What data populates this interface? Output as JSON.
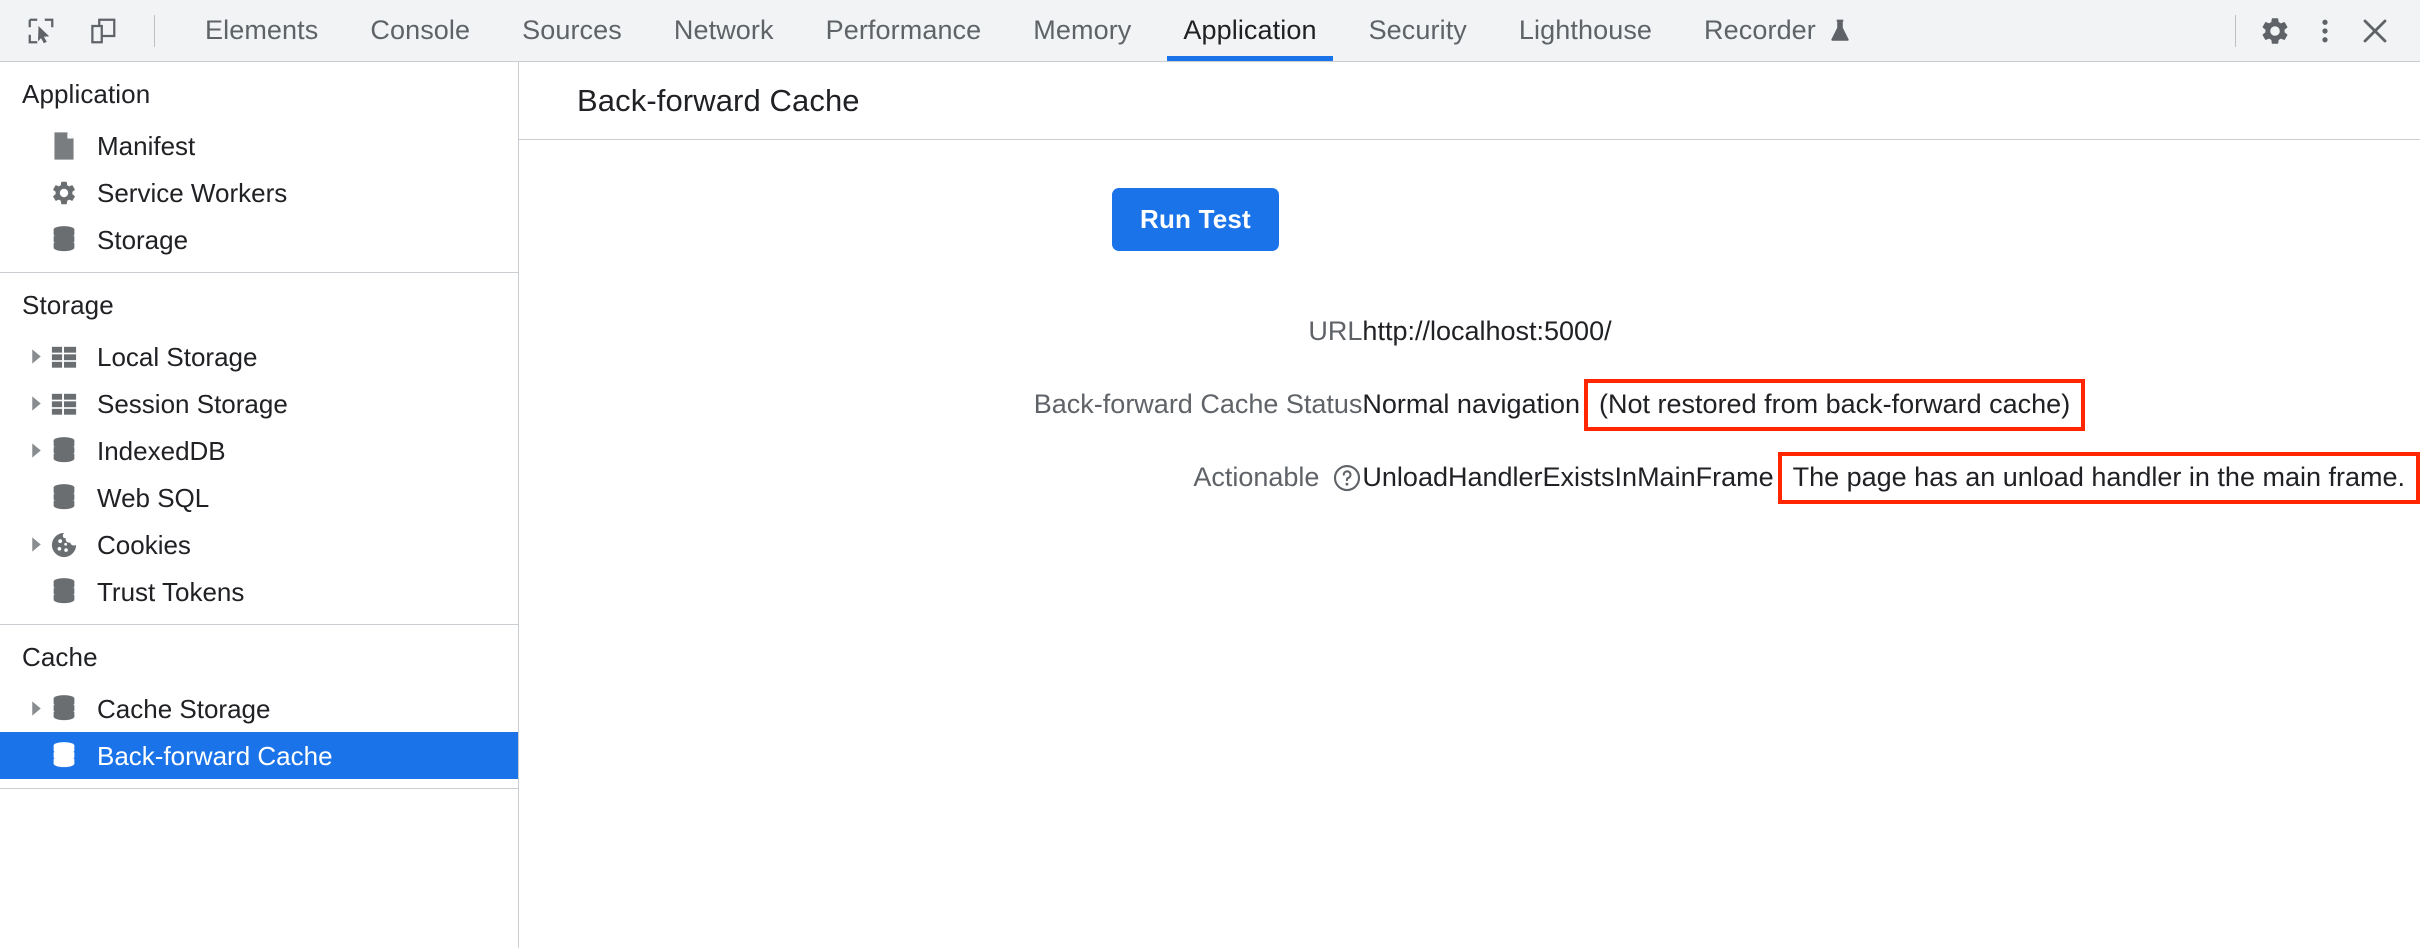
{
  "toolbar": {
    "inspect_icon": "inspect-cursor-icon",
    "device_toolbar_icon": "device-toolbar-icon",
    "tabs": [
      {
        "label": "Elements",
        "active": false
      },
      {
        "label": "Console",
        "active": false
      },
      {
        "label": "Sources",
        "active": false
      },
      {
        "label": "Network",
        "active": false
      },
      {
        "label": "Performance",
        "active": false
      },
      {
        "label": "Memory",
        "active": false
      },
      {
        "label": "Application",
        "active": true
      },
      {
        "label": "Security",
        "active": false
      },
      {
        "label": "Lighthouse",
        "active": false
      },
      {
        "label": "Recorder",
        "active": false,
        "trailing_icon": "flask-icon"
      }
    ],
    "settings_icon": "gear-icon",
    "more_icon": "kebab-menu-icon",
    "close_icon": "close-icon",
    "accent_color": "#1a73e8"
  },
  "sidebar": {
    "sections": [
      {
        "title": "Application",
        "items": [
          {
            "label": "Manifest",
            "icon": "document-icon",
            "expandable": false,
            "selected": false
          },
          {
            "label": "Service Workers",
            "icon": "gear-icon",
            "expandable": false,
            "selected": false
          },
          {
            "label": "Storage",
            "icon": "database-icon",
            "expandable": false,
            "selected": false
          }
        ]
      },
      {
        "title": "Storage",
        "items": [
          {
            "label": "Local Storage",
            "icon": "table-icon",
            "expandable": true,
            "selected": false
          },
          {
            "label": "Session Storage",
            "icon": "table-icon",
            "expandable": true,
            "selected": false
          },
          {
            "label": "IndexedDB",
            "icon": "database-icon",
            "expandable": true,
            "selected": false
          },
          {
            "label": "Web SQL",
            "icon": "database-icon",
            "expandable": false,
            "selected": false
          },
          {
            "label": "Cookies",
            "icon": "cookie-icon",
            "expandable": true,
            "selected": false
          },
          {
            "label": "Trust Tokens",
            "icon": "database-icon",
            "expandable": false,
            "selected": false
          }
        ]
      },
      {
        "title": "Cache",
        "items": [
          {
            "label": "Cache Storage",
            "icon": "database-icon",
            "expandable": true,
            "selected": false
          },
          {
            "label": "Back-forward Cache",
            "icon": "database-icon",
            "expandable": false,
            "selected": true
          }
        ]
      }
    ],
    "selected_bg": "#1a73e8"
  },
  "main": {
    "title": "Back-forward Cache",
    "run_test_label": "Run Test",
    "rows": [
      {
        "label": "URL",
        "has_help": false,
        "value_plain": "http://localhost:5000/",
        "value_boxed": ""
      },
      {
        "label": "Back-forward Cache Status",
        "has_help": false,
        "value_plain": "Normal navigation",
        "value_boxed": "(Not restored from back-forward cache)"
      },
      {
        "label": "Actionable",
        "has_help": true,
        "help_icon": "help-circle-icon",
        "value_plain": "UnloadHandlerExistsInMainFrame",
        "value_boxed": "The page has an unload handler in the main frame."
      }
    ],
    "annotation_color": "#ff2600"
  }
}
